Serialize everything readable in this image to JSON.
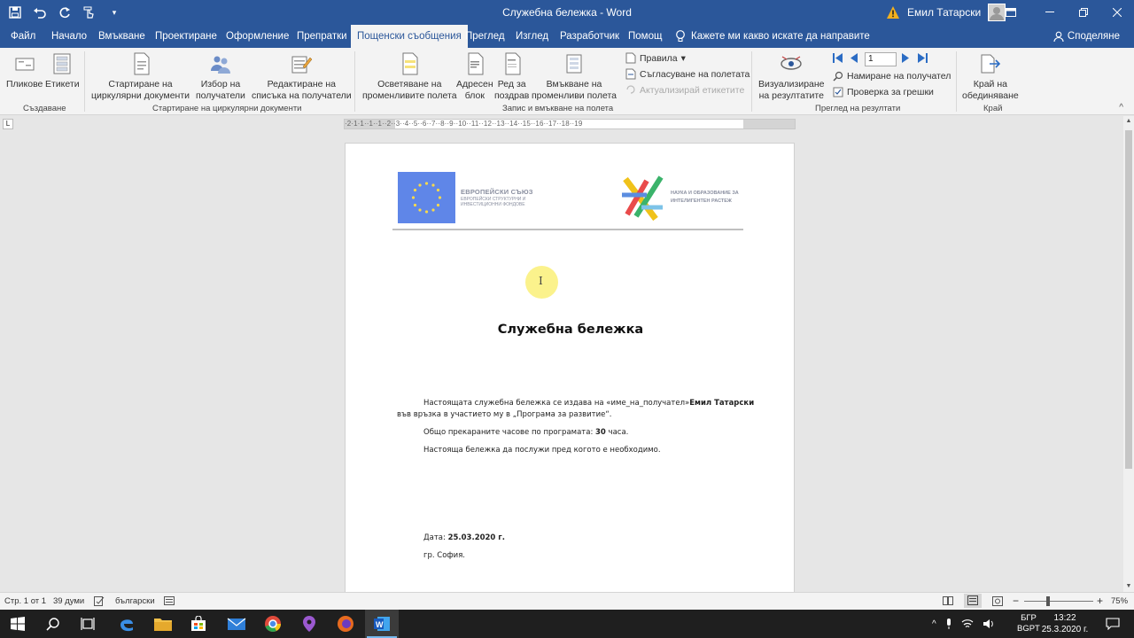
{
  "window": {
    "title": "Служебна бележка  -  Word",
    "user": "Емил Татарски"
  },
  "qat": {
    "save": "save-icon",
    "undo": "undo-icon",
    "redo": "redo-icon",
    "touch": "touch-mode-icon",
    "more": "▾"
  },
  "tabs": [
    {
      "label": "Файл"
    },
    {
      "label": "Начало"
    },
    {
      "label": "Вмъкване"
    },
    {
      "label": "Проектиране"
    },
    {
      "label": "Оформление"
    },
    {
      "label": "Препратки"
    },
    {
      "label": "Пощенски съобщения"
    },
    {
      "label": "Преглед"
    },
    {
      "label": "Изглед"
    },
    {
      "label": "Разработчик"
    },
    {
      "label": "Помощ"
    }
  ],
  "tell_me": "Кажете ми какво искате да направите",
  "share": "Споделяне",
  "ribbon": {
    "envelopes": "Пликове",
    "labels": "Етикети",
    "start_merge_1": "Стартиране на",
    "start_merge_2": "циркулярни документи",
    "select_recipients_1": "Избор на",
    "select_recipients_2": "получатели",
    "edit_list_1": "Редактиране на",
    "edit_list_2": "списъка на получатели",
    "highlight_1": "Осветяване на",
    "highlight_2": "променливите полета",
    "address_1": "Адресен",
    "address_2": "блок",
    "greeting_1": "Ред за",
    "greeting_2": "поздрав",
    "insert_field_1": "Вмъкване на",
    "insert_field_2": "променливи полета",
    "rules": "Правила",
    "match_fields": "Съгласуване на полетата",
    "update_labels": "Актуализирай етикетите",
    "preview_1": "Визуализиране",
    "preview_2": "на резултатите",
    "record_number": "1",
    "find_recipient": "Намиране на получател",
    "check_errors": "Проверка за грешки",
    "finish_1": "Край на",
    "finish_2": "обединяване",
    "group_create": "Създаване",
    "group_start": "Стартиране на циркулярни документи",
    "group_write": "Запис и вмъкване на полета",
    "group_preview": "Преглед на резултати",
    "group_finish": "Край"
  },
  "ruler": {
    "ticks": "·2·1·1··1··1··2··3··4··5··6··7··8··9··10··11··12··13··14··15··16··17··18··19"
  },
  "document": {
    "eu_title": "ЕВРОПЕЙСКИ СЪЮЗ",
    "eu_sub": "ЕВРОПЕЙСКИ СТРУКТУРНИ И ИНВЕСТИЦИОННИ ФОНДОВЕ",
    "sci_line1": "НАУКА И ОБРАЗОВАНИЕ ЗА",
    "sci_line2": "ИНТЕЛИГЕНТЕН РАСТЕЖ",
    "heading": "Служебна бележка",
    "p1_text": "Настоящата служебна бележка се издава на «име_на_получател»",
    "p1_name": "Емил Татарски",
    "p1_cont": "във връзка в участието му в „Програма за развитие“.",
    "p2_text": "Общо прекараните часове по програмата: ",
    "p2_hours": "30",
    "p2_unit": " часа.",
    "p3_text": "Настояща бележка да послужи пред когото е необходимо.",
    "date_label": "Дата: ",
    "date_value": "25.03.2020 г.",
    "city": "гр. София."
  },
  "status": {
    "page": "Стр. 1 от 1",
    "words": "39 думи",
    "language": "български",
    "zoom": "75%",
    "zoom_minus": "−",
    "zoom_plus": "+"
  },
  "taskbar": {
    "lang1": "БГР",
    "lang2": "BGPT",
    "time": "13:22",
    "date": "25.3.2020 г."
  },
  "colors": {
    "word_blue": "#2b579a",
    "eu_blue": "#5f86e8"
  }
}
